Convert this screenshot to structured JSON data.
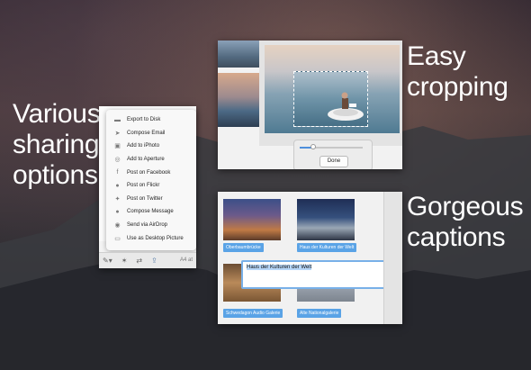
{
  "headlines": {
    "sharing": "Various sharing options",
    "cropping": "Easy cropping",
    "captions": "Gorgeous captions"
  },
  "share_menu": {
    "items": [
      {
        "label": "Export to Disk",
        "icon": "folder-icon"
      },
      {
        "label": "Compose Email",
        "icon": "mail-icon"
      },
      {
        "label": "Add to iPhoto",
        "icon": "iphoto-icon"
      },
      {
        "label": "Add to Aperture",
        "icon": "aperture-icon"
      },
      {
        "label": "Post on Facebook",
        "icon": "facebook-icon"
      },
      {
        "label": "Post on Flickr",
        "icon": "flickr-icon"
      },
      {
        "label": "Post on Twitter",
        "icon": "twitter-icon"
      },
      {
        "label": "Compose Message",
        "icon": "message-icon"
      },
      {
        "label": "Send via AirDrop",
        "icon": "airdrop-icon"
      },
      {
        "label": "Use as Desktop Picture",
        "icon": "desktop-icon"
      }
    ]
  },
  "share_toolbar": {
    "page_size": "A4 at"
  },
  "crop_panel": {
    "done_label": "Done",
    "zoom_level": 0.22
  },
  "captions": {
    "editor_text": "Haus der Kulturen der Welt",
    "labels": [
      "Oberbaumbrücke",
      "Haus der Kulturen der Welt",
      "Schwedagon Audio Galerie",
      "Alte Nationalgalerie"
    ]
  },
  "colors": {
    "caption_label": "#5aa3e6",
    "slider_fill": "#4e8fdc"
  }
}
